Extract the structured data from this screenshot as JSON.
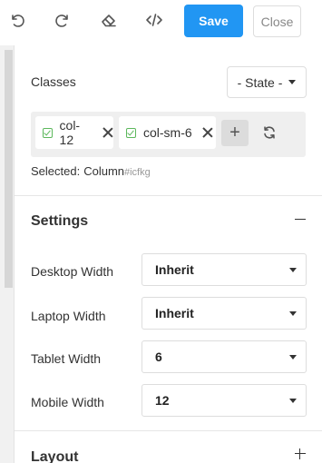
{
  "toolbar": {
    "undo_icon": "undo-icon",
    "redo_icon": "redo-icon",
    "eraser_icon": "eraser-icon",
    "code_icon": "code-icon",
    "save_label": "Save",
    "close_label": "Close",
    "save_color": "#2196f3"
  },
  "classes": {
    "label": "Classes",
    "state_label": "- State -",
    "tags": [
      {
        "label": "col-12"
      },
      {
        "label": "col-sm-6"
      }
    ],
    "add_label": "+",
    "selected_label": "Selected:",
    "selected_value": "Column",
    "selected_id": "#icfkg"
  },
  "settings": {
    "title": "Settings",
    "fields": [
      {
        "label": "Desktop Width",
        "value": "Inherit"
      },
      {
        "label": "Laptop Width",
        "value": "Inherit"
      },
      {
        "label": "Tablet Width",
        "value": "6"
      },
      {
        "label": "Mobile Width",
        "value": "12"
      }
    ]
  },
  "layout": {
    "title": "Layout"
  }
}
